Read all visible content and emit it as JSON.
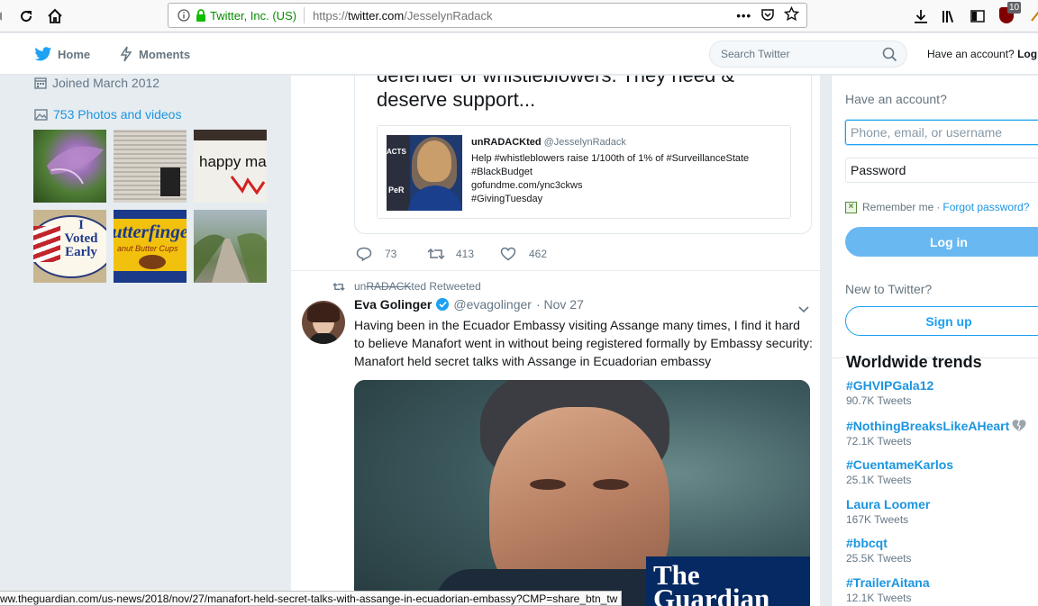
{
  "browser": {
    "org_label": "Twitter, Inc. (US)",
    "url_prefix": "https://",
    "url_domain": "twitter.com",
    "url_path": "/JesselynRadack",
    "ublock_count": "10"
  },
  "nav": {
    "home": "Home",
    "moments": "Moments",
    "search_placeholder": "Search Twitter",
    "have_account": "Have an account?",
    "login_link": "Log"
  },
  "profile": {
    "joined": "Joined March 2012",
    "photos": "753 Photos and videos",
    "thumb_happy_text": "happy ma",
    "thumb_voted_line1": "I",
    "thumb_voted_line2": "Voted",
    "thumb_voted_line3": "Early",
    "thumb_butter_text": "utterfinge",
    "thumb_butter_sub": "anut Butter Cups"
  },
  "quoted": {
    "text": "defender of whistleblowers. They need & deserve support...",
    "nested_author": "unRADACKted",
    "nested_handle": "@JesselynRadack",
    "nested_body_1": "Help #whistleblowers raise 1/100th of 1% of #SurveillanceState",
    "nested_body_2": "#BlackBudget",
    "nested_body_3": "gofundme.com/ync3ckws",
    "nested_body_4": "#GivingTuesday",
    "nested_img_label_1": "ACTS",
    "nested_img_label_2": "PeR",
    "replies": "73",
    "retweets": "413",
    "likes": "462"
  },
  "tweet": {
    "retweet_by_prefix": "un",
    "retweet_by_strike": "RADACK",
    "retweet_by_suffix": "ted Retweeted",
    "name": "Eva Golinger",
    "handle": "@evagolinger",
    "date": "· Nov 27",
    "text": "Having been in the Ecuador Embassy visiting Assange many times, I find it hard to believe Manafort went in without being registered formally by Embassy security: Manafort held secret talks with Assange in Ecuadorian embassy",
    "media_brand_1": "The",
    "media_brand_2": "Guardian"
  },
  "login": {
    "title": "Have an account?",
    "user_placeholder": "Phone, email, or username",
    "password_placeholder": "Password",
    "remember": "Remember me",
    "dot": "·",
    "forgot": "Forgot password?",
    "login_button": "Log in",
    "new_to": "New to Twitter?",
    "signup_button": "Sign up"
  },
  "trends": {
    "title": "Worldwide trends",
    "items": [
      {
        "name": "#GHVIPGala12",
        "count": "90.7K Tweets"
      },
      {
        "name": "#NothingBreaksLikeAHeart",
        "count": "72.1K Tweets"
      },
      {
        "name": "#CuentameKarlos",
        "count": "25.1K Tweets"
      },
      {
        "name": "Laura Loomer",
        "count": "167K Tweets"
      },
      {
        "name": "#bbcqt",
        "count": "25.5K Tweets"
      },
      {
        "name": "#TrailerAitana",
        "count": "12.1K Tweets"
      }
    ]
  },
  "status_bar": {
    "url": "ww.theguardian.com/us-news/2018/nov/27/manafort-held-secret-talks-with-assange-in-ecuadorian-embassy?CMP=share_btn_tw"
  },
  "colors": {
    "accent": "#1da1f2",
    "link": "#1b95e0",
    "background": "#e6ecf0",
    "guardian": "#052962"
  }
}
